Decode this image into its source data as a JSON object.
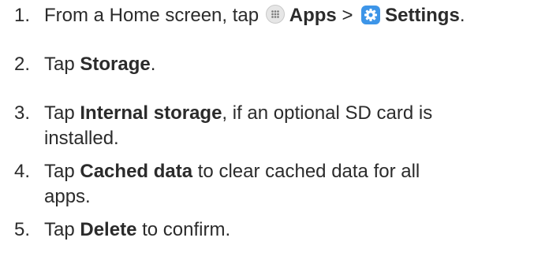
{
  "steps": [
    {
      "number": "1.",
      "pre": "From a Home screen, tap",
      "apps_label": "Apps",
      "sep": ">",
      "settings_label": "Settings",
      "post": "."
    },
    {
      "number": "2.",
      "pre": "Tap",
      "bold": "Storage",
      "post": "."
    },
    {
      "number": "3.",
      "pre": "Tap",
      "bold": "Internal storage",
      "post": ", if an optional SD card is",
      "cont": "installed."
    },
    {
      "number": "4.",
      "pre": "Tap",
      "bold": "Cached data",
      "post": " to clear cached data for all",
      "cont": "apps."
    },
    {
      "number": "5.",
      "pre": "Tap",
      "bold": "Delete",
      "post": " to confirm."
    }
  ],
  "icons": {
    "apps": "apps-grid-icon",
    "settings": "gear-icon",
    "settings_color": "#3d95e8"
  }
}
